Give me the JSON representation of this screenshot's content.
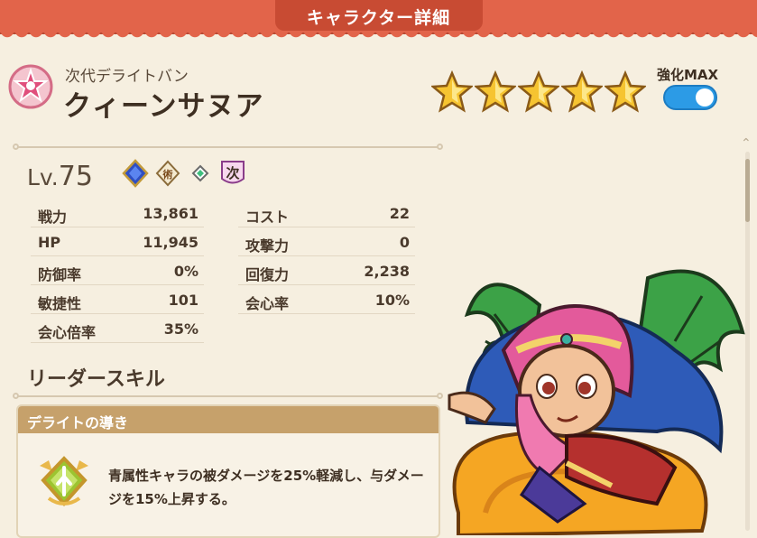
{
  "header": {
    "title": "キャラクター詳細",
    "subtitle": "次代デライトバン",
    "name": "クィーンサヌア",
    "enhance_label": "強化MAX",
    "star_count": 5,
    "enhance_on": true
  },
  "stats": {
    "level_prefix": "Lv.",
    "level": "75",
    "badge_label": "術",
    "next_label": "次",
    "left": [
      {
        "label": "戦力",
        "value": "13,861"
      },
      {
        "label": "HP",
        "value": "11,945"
      },
      {
        "label": "防御率",
        "value": "0%"
      },
      {
        "label": "敏捷性",
        "value": "101"
      },
      {
        "label": "会心倍率",
        "value": "35%"
      }
    ],
    "right": [
      {
        "label": "コスト",
        "value": "22"
      },
      {
        "label": "攻撃力",
        "value": "0"
      },
      {
        "label": "回復力",
        "value": "2,238"
      },
      {
        "label": "会心率",
        "value": "10%"
      }
    ]
  },
  "leader_skill": {
    "section_title": "リーダースキル",
    "name": "デライトの導き",
    "description": "青属性キャラの被ダメージを25%軽減し、与ダメージを15%上昇する。"
  },
  "colors": {
    "banner": "#e2644a",
    "toggle": "#2c9be6",
    "skill_header": "#c6a16b",
    "star": "#f6c431"
  }
}
